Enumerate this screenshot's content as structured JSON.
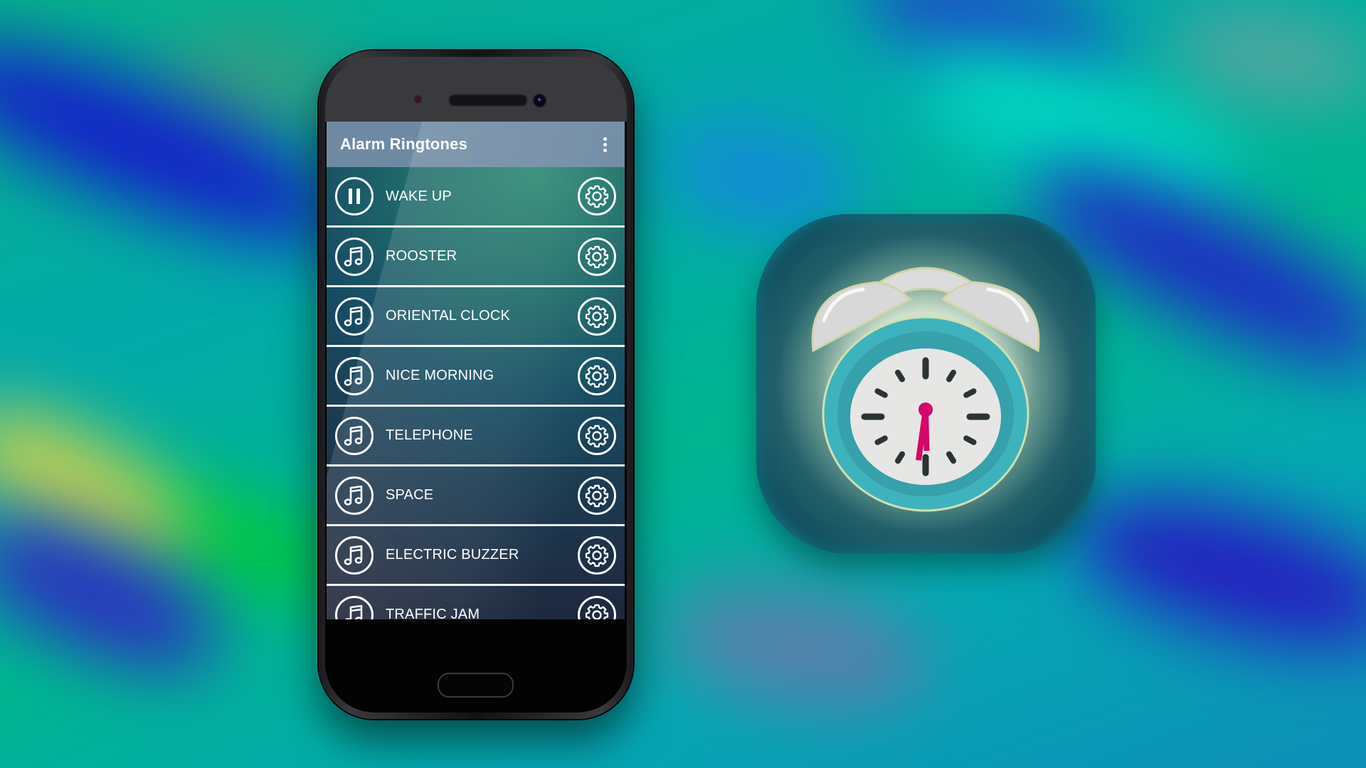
{
  "app": {
    "title": "Alarm Ringtones",
    "menu_icon": "more-vertical-icon"
  },
  "ringtones": [
    {
      "label": "WAKE UP",
      "state": "playing",
      "play_icon": "pause-icon",
      "settings_icon": "gear-icon"
    },
    {
      "label": "ROOSTER",
      "state": "stopped",
      "play_icon": "music-note-icon",
      "settings_icon": "gear-icon"
    },
    {
      "label": "ORIENTAL CLOCK",
      "state": "stopped",
      "play_icon": "music-note-icon",
      "settings_icon": "gear-icon"
    },
    {
      "label": "NICE MORNING",
      "state": "stopped",
      "play_icon": "music-note-icon",
      "settings_icon": "gear-icon"
    },
    {
      "label": "TELEPHONE",
      "state": "stopped",
      "play_icon": "music-note-icon",
      "settings_icon": "gear-icon"
    },
    {
      "label": "SPACE",
      "state": "stopped",
      "play_icon": "music-note-icon",
      "settings_icon": "gear-icon"
    },
    {
      "label": "ELECTRIC BUZZER",
      "state": "stopped",
      "play_icon": "music-note-icon",
      "settings_icon": "gear-icon"
    },
    {
      "label": "TRAFFIC JAM",
      "state": "stopped",
      "play_icon": "music-note-icon",
      "settings_icon": "gear-icon"
    }
  ],
  "app_icon": {
    "icon": "alarm-clock-icon",
    "clock_time": "6:33",
    "colors": {
      "clock_body": "#3fb3bd",
      "clock_face": "#e6e6e4",
      "hands": "#d4066a",
      "ticks": "#2b3433",
      "bells": "#dadada"
    }
  },
  "colors": {
    "header_bg": "#6e8aa3",
    "divider": "#f2f2f2",
    "text": "#ffffff"
  }
}
